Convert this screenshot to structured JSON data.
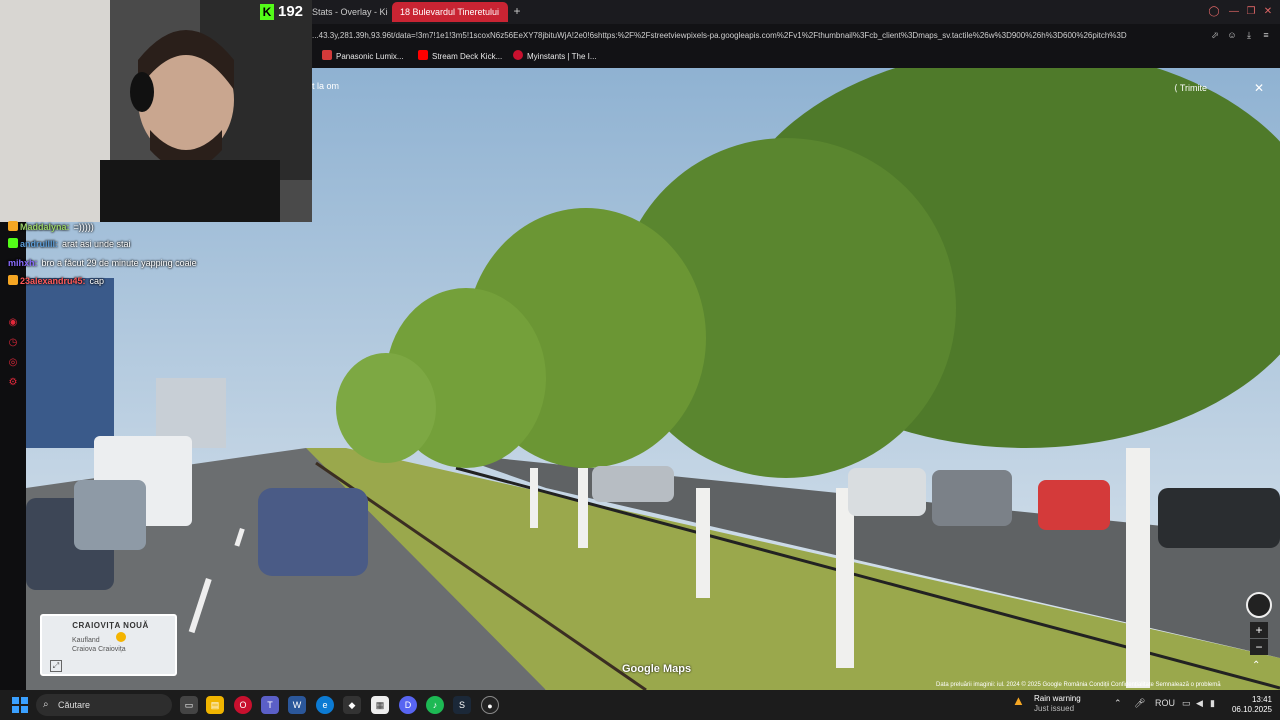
{
  "browser": {
    "tabs": [
      {
        "label": "Stats - Overlay - Kic",
        "active": false
      },
      {
        "label": "18 Bulevardul Tineretului",
        "active": true
      }
    ],
    "new_tab_icon": "plus-icon",
    "url": "...43.3y,281.39h,93.96t/data=!3m7!1e1!3m5!1scoxN6z56EeXY78jbituWjA!2e0!6shttps:%2F%2Fstreetviewpixels-pa.googleapis.com%2Fv1%2Fthumbnail%3Fcb_client%3Dmaps_sv.tactile%26w%3D900%26h%3D600%26pitch%3D",
    "bookmarks": [
      {
        "label": "Panasonic Lumix...",
        "color": "#d23a3a"
      },
      {
        "label": "Stream Deck Kick...",
        "color": "#ff0000"
      },
      {
        "label": "Myinstants | The I...",
        "color": "#c8102e"
      }
    ]
  },
  "streetview": {
    "top_label": "t la om",
    "share_label": "Trimite",
    "close_icon": "close-icon",
    "minimap": {
      "title": "CRAIOVIȚA NOUĂ",
      "place1": "Kaufland",
      "place2": "Craiova Craiovița"
    },
    "watermark": "Google Maps",
    "imagery_line": "Data preluării imaginii: iul. 2024    © 2025 Google    România    Condiții    Confidențialitate    Semnalează o problemă"
  },
  "stream": {
    "viewer_count": "192",
    "chat": [
      {
        "user": "Maddalyna:",
        "message": "=)))))",
        "color": "#9bd36b"
      },
      {
        "user": "andrullll:",
        "message": "arat asi unde stai",
        "color": "#5b9bd5"
      },
      {
        "user": "mihxh:",
        "message": "bro a făcut 29 de minute yapping coaie",
        "color": "#8a6cff"
      },
      {
        "user": "23alexandru45:",
        "message": "cap",
        "color": "#ff5a5a"
      }
    ]
  },
  "taskbar": {
    "search_placeholder": "Căutare",
    "weather_title": "Rain warning",
    "weather_sub": "Just issued",
    "language": "ROU",
    "time": "13:41",
    "date": "06.10.2025"
  },
  "colors": {
    "accent_tab": "#c92433",
    "kick_green": "#53fc18"
  }
}
